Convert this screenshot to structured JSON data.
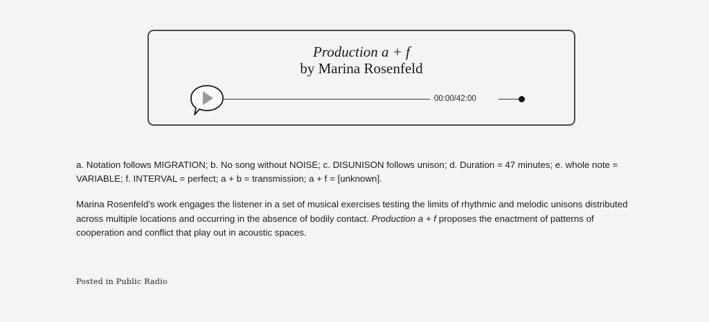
{
  "player": {
    "title": "Production a + f",
    "byline": "by Marina Rosenfeld",
    "time": "00:00/42:00",
    "play_icon": "play-speech-bubble-icon",
    "progress": 0
  },
  "notes": "a. Notation follows MIGRATION; b. No song without NOISE; c. DISUNISON follows unison; d. Duration = 47 minutes; e. whole note = VARIABLE; f. INTERVAL = perfect; a + b = transmission; a + f = [unknown].",
  "description": {
    "text_1": "Marina Rosenfeld’s work engages the listener in a set of musical exercises testing the limits of rhythmic and melodic unisons distributed across multiple locations and occurring in the absence of bodily contact. ",
    "work_title": "Production a + f",
    "text_2": " proposes the enactment of patterns of cooperation and conflict that play out in acoustic spaces."
  },
  "posted": {
    "prefix": "Posted in ",
    "category": "Public Radio"
  }
}
